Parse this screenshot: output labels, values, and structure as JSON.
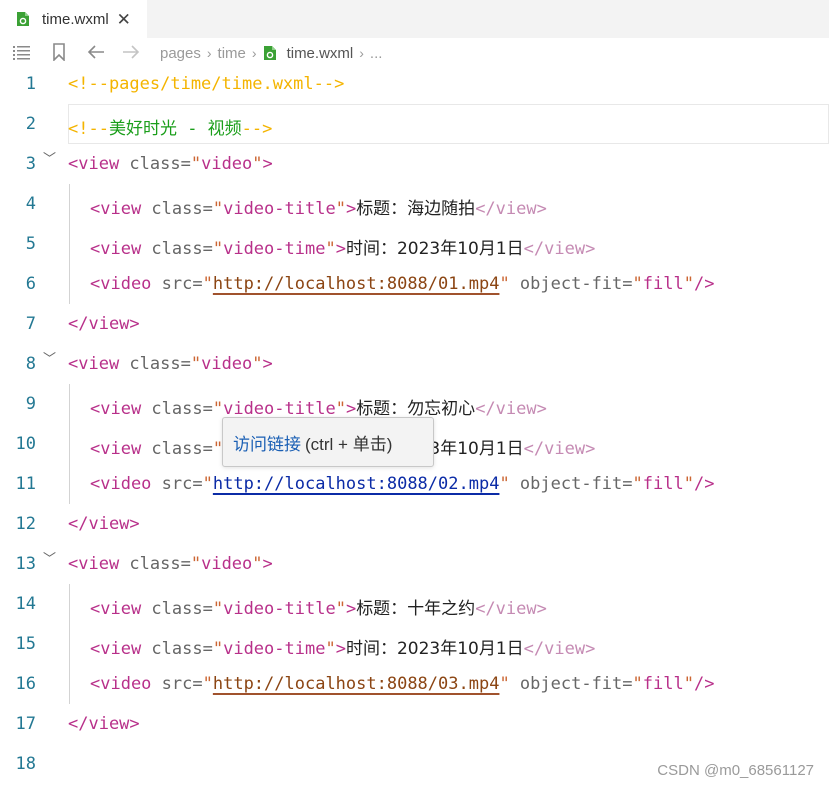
{
  "tab": {
    "label": "time.wxml",
    "close": "✕"
  },
  "breadcrumb": {
    "items": [
      "pages",
      "time",
      "time.wxml"
    ],
    "ellipsis": "..."
  },
  "lines": [
    {
      "n": "1",
      "fold": "",
      "indent": 0,
      "tokens": [
        [
          "t-comment",
          "<!--pages/time/time.wxml-->"
        ]
      ]
    },
    {
      "n": "2",
      "fold": "",
      "indent": 0,
      "highlight": true,
      "tokens": [
        [
          "t-comment",
          "<!--"
        ],
        [
          "t-ctext",
          "美好时光 - 视频"
        ],
        [
          "t-comment",
          "-->"
        ]
      ]
    },
    {
      "n": "3",
      "fold": "﹀",
      "indent": 0,
      "tokens": [
        [
          "t-tag",
          "<view "
        ],
        [
          "t-attr",
          "class="
        ],
        [
          "t-str",
          "\""
        ],
        [
          "t-val",
          "video"
        ],
        [
          "t-str",
          "\""
        ],
        [
          "t-tag",
          ">"
        ]
      ]
    },
    {
      "n": "4",
      "fold": "",
      "indent": 1,
      "tokens": [
        [
          "t-tag",
          "<view "
        ],
        [
          "t-attr",
          "class="
        ],
        [
          "t-str",
          "\""
        ],
        [
          "t-val",
          "video-title"
        ],
        [
          "t-str",
          "\""
        ],
        [
          "t-tag",
          ">"
        ],
        [
          "t-text",
          "标题：海边随拍"
        ],
        [
          "t-tag-dim",
          "</view>"
        ]
      ]
    },
    {
      "n": "5",
      "fold": "",
      "indent": 1,
      "tokens": [
        [
          "t-tag",
          "<view "
        ],
        [
          "t-attr",
          "class="
        ],
        [
          "t-str",
          "\""
        ],
        [
          "t-val",
          "video-time"
        ],
        [
          "t-str",
          "\""
        ],
        [
          "t-tag",
          ">"
        ],
        [
          "t-text",
          "时间：2023年10月1日"
        ],
        [
          "t-tag-dim",
          "</view>"
        ]
      ]
    },
    {
      "n": "6",
      "fold": "",
      "indent": 1,
      "tokens": [
        [
          "t-tag",
          "<video "
        ],
        [
          "t-attr",
          "src="
        ],
        [
          "t-str",
          "\""
        ],
        [
          "t-link",
          "http://localhost:8088/01.mp4"
        ],
        [
          "t-str",
          "\""
        ],
        [
          "t-attr",
          " object-fit="
        ],
        [
          "t-str",
          "\""
        ],
        [
          "t-val",
          "fill"
        ],
        [
          "t-str",
          "\""
        ],
        [
          "t-tag",
          "/>"
        ]
      ]
    },
    {
      "n": "7",
      "fold": "",
      "indent": 0,
      "tokens": [
        [
          "t-tag",
          "</view>"
        ]
      ]
    },
    {
      "n": "8",
      "fold": "﹀",
      "indent": 0,
      "tokens": [
        [
          "t-tag",
          "<view "
        ],
        [
          "t-attr",
          "class="
        ],
        [
          "t-str",
          "\""
        ],
        [
          "t-val",
          "video"
        ],
        [
          "t-str",
          "\""
        ],
        [
          "t-tag",
          ">"
        ]
      ]
    },
    {
      "n": "9",
      "fold": "",
      "indent": 1,
      "tokens": [
        [
          "t-tag",
          "<view "
        ],
        [
          "t-attr",
          "class="
        ],
        [
          "t-str",
          "\""
        ],
        [
          "t-val",
          "video-title"
        ],
        [
          "t-str",
          "\""
        ],
        [
          "t-tag",
          ">"
        ],
        [
          "t-text",
          "标题：勿忘初心"
        ],
        [
          "t-tag-dim",
          "</view>"
        ]
      ]
    },
    {
      "n": "10",
      "fold": "",
      "indent": 1,
      "tokens": [
        [
          "t-tag",
          "<view "
        ],
        [
          "t-attr",
          "class="
        ],
        [
          "t-str",
          "\""
        ],
        [
          "t-val",
          "video-time"
        ],
        [
          "t-str",
          "\""
        ],
        [
          "t-tag",
          ">"
        ],
        [
          "t-text",
          "时间：2023年10月1日"
        ],
        [
          "t-tag-dim",
          "</view>"
        ]
      ]
    },
    {
      "n": "11",
      "fold": "",
      "indent": 1,
      "tokens": [
        [
          "t-tag",
          "<video "
        ],
        [
          "t-attr",
          "src="
        ],
        [
          "t-str",
          "\""
        ],
        [
          "t-link-active",
          "http://localhost:8088/02.mp4"
        ],
        [
          "t-str",
          "\""
        ],
        [
          "t-attr",
          " object-fit="
        ],
        [
          "t-str",
          "\""
        ],
        [
          "t-val",
          "fill"
        ],
        [
          "t-str",
          "\""
        ],
        [
          "t-tag",
          "/>"
        ]
      ]
    },
    {
      "n": "12",
      "fold": "",
      "indent": 0,
      "tokens": [
        [
          "t-tag",
          "</view>"
        ]
      ]
    },
    {
      "n": "13",
      "fold": "﹀",
      "indent": 0,
      "tokens": [
        [
          "t-tag",
          "<view "
        ],
        [
          "t-attr",
          "class="
        ],
        [
          "t-str",
          "\""
        ],
        [
          "t-val",
          "video"
        ],
        [
          "t-str",
          "\""
        ],
        [
          "t-tag",
          ">"
        ]
      ]
    },
    {
      "n": "14",
      "fold": "",
      "indent": 1,
      "tokens": [
        [
          "t-tag",
          "<view "
        ],
        [
          "t-attr",
          "class="
        ],
        [
          "t-str",
          "\""
        ],
        [
          "t-val",
          "video-title"
        ],
        [
          "t-str",
          "\""
        ],
        [
          "t-tag",
          ">"
        ],
        [
          "t-text",
          "标题：十年之约"
        ],
        [
          "t-tag-dim",
          "</view>"
        ]
      ]
    },
    {
      "n": "15",
      "fold": "",
      "indent": 1,
      "tokens": [
        [
          "t-tag",
          "<view "
        ],
        [
          "t-attr",
          "class="
        ],
        [
          "t-str",
          "\""
        ],
        [
          "t-val",
          "video-time"
        ],
        [
          "t-str",
          "\""
        ],
        [
          "t-tag",
          ">"
        ],
        [
          "t-text",
          "时间：2023年10月1日"
        ],
        [
          "t-tag-dim",
          "</view>"
        ]
      ]
    },
    {
      "n": "16",
      "fold": "",
      "indent": 1,
      "tokens": [
        [
          "t-tag",
          "<video "
        ],
        [
          "t-attr",
          "src="
        ],
        [
          "t-str",
          "\""
        ],
        [
          "t-link",
          "http://localhost:8088/03.mp4"
        ],
        [
          "t-str",
          "\""
        ],
        [
          "t-attr",
          " object-fit="
        ],
        [
          "t-str",
          "\""
        ],
        [
          "t-val",
          "fill"
        ],
        [
          "t-str",
          "\""
        ],
        [
          "t-tag",
          "/>"
        ]
      ]
    },
    {
      "n": "17",
      "fold": "",
      "indent": 0,
      "tokens": [
        [
          "t-tag",
          "</view>"
        ]
      ]
    },
    {
      "n": "18",
      "fold": "",
      "indent": 0,
      "tokens": []
    }
  ],
  "tooltip": {
    "link_text": "访问链接",
    "rest": "(ctrl + 单击)"
  },
  "watermark": "CSDN @m0_68561127",
  "colors": {
    "line_number": "#237893",
    "tag": "#b8308a",
    "comment": "#f4b400",
    "link": "#0b2ba6"
  }
}
